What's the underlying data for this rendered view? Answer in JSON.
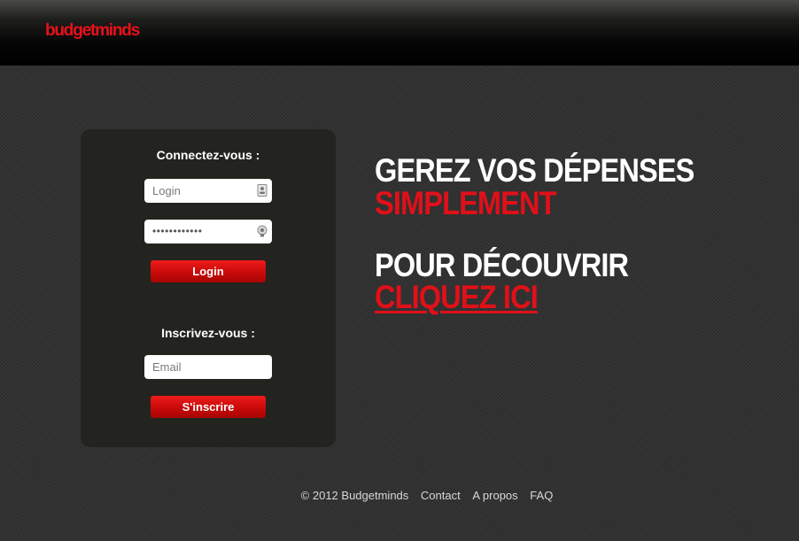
{
  "header": {
    "logo_text": "budgetminds",
    "brand_color": "#e8101a"
  },
  "login_panel": {
    "login_heading": "Connectez-vous :",
    "login_placeholder": "Login",
    "password_value": "••••••••••••",
    "login_button": "Login",
    "signup_heading": "Inscrivez-vous :",
    "email_placeholder": "Email",
    "signup_button": "S'inscrire",
    "login_field_icon": "id-card-icon",
    "password_field_icon": "lock-icon"
  },
  "hero": {
    "line1": "GEREZ VOS DÉPENSES",
    "line2": "SIMPLEMENT",
    "line3": "POUR DÉCOUVRIR",
    "line4_link": "CLIQUEZ ICI",
    "accent_color": "#e01019"
  },
  "footer": {
    "copyright": "© 2012 Budgetminds",
    "links": [
      "Contact",
      "A propos",
      "FAQ"
    ]
  }
}
